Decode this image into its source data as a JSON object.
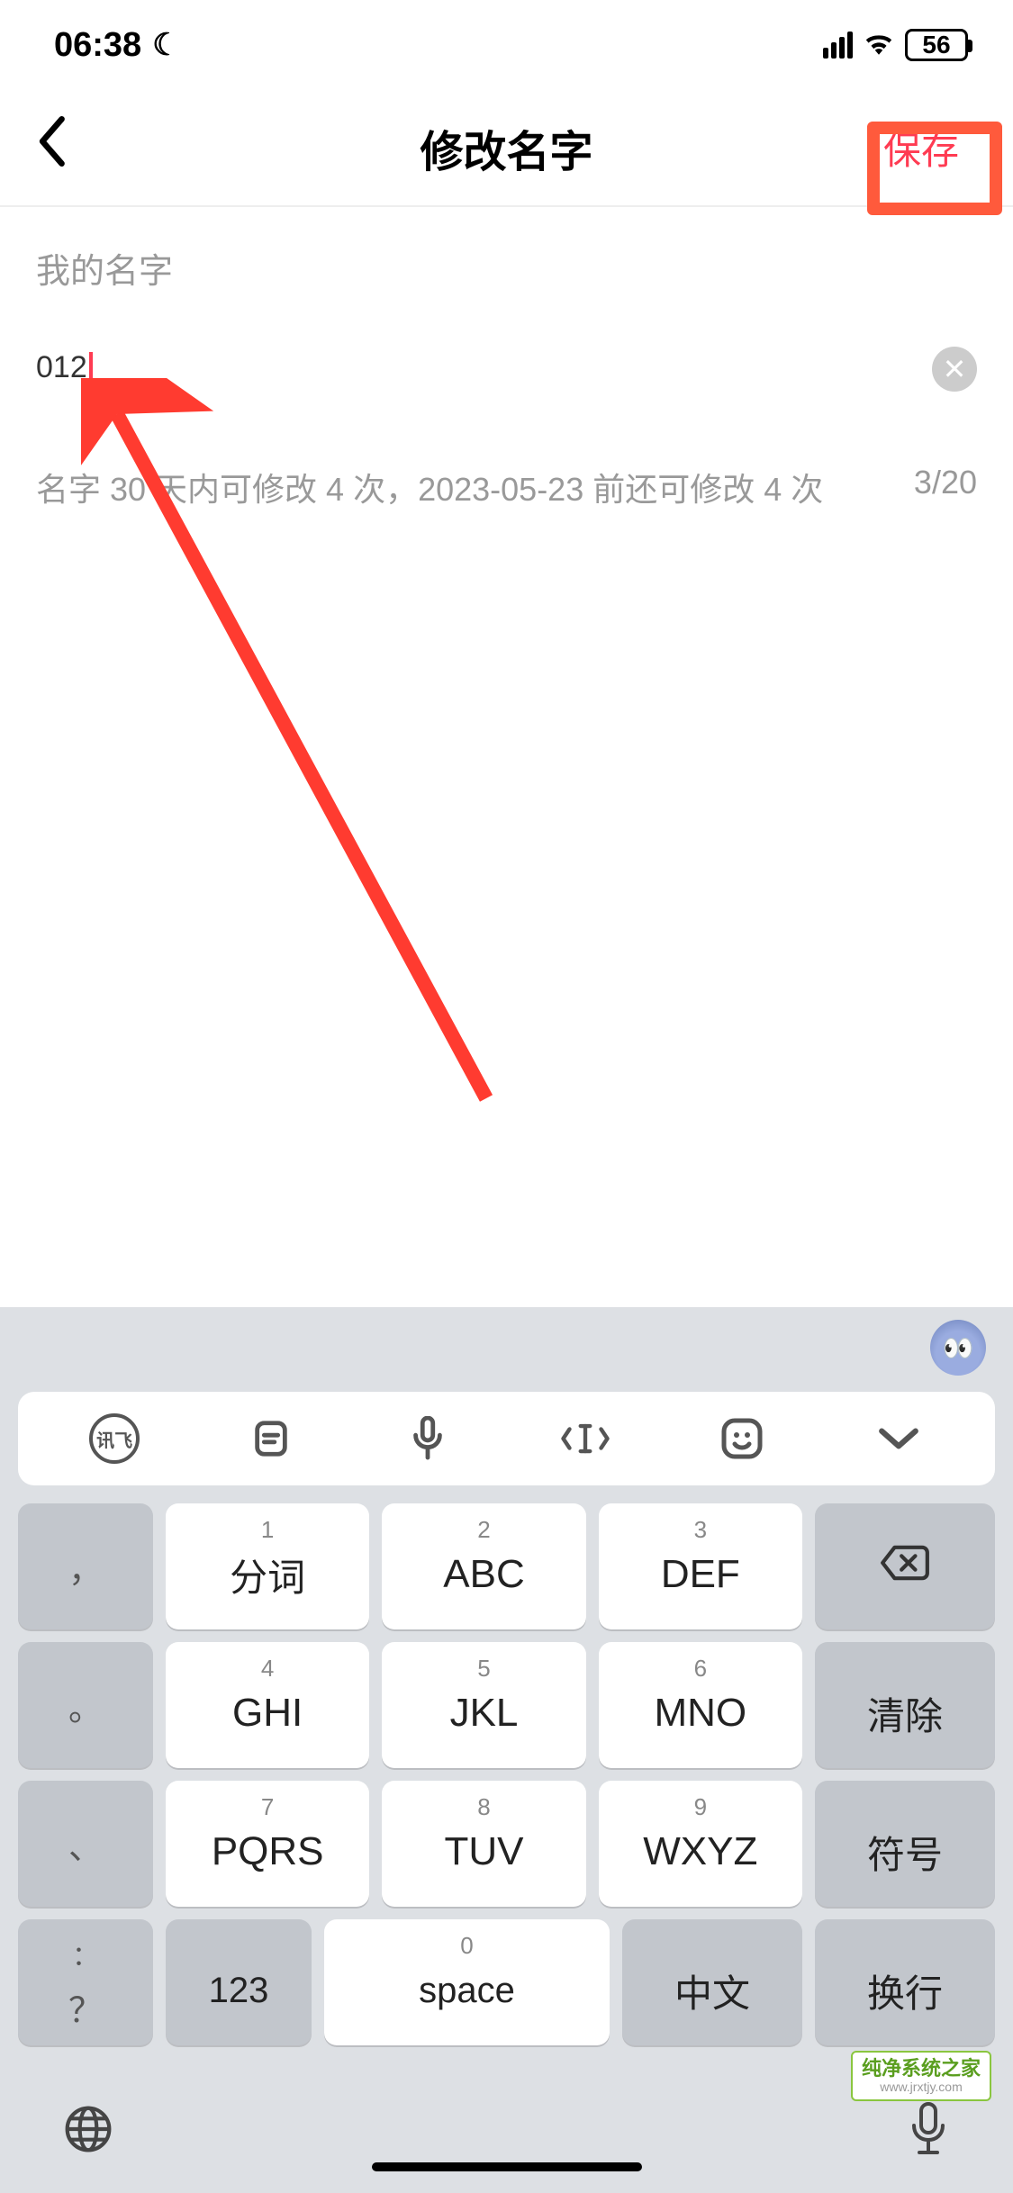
{
  "status": {
    "time": "06:38",
    "battery": "56"
  },
  "header": {
    "title": "修改名字",
    "save": "保存"
  },
  "form": {
    "label": "我的名字",
    "value": "012",
    "hint": "名字 30 天内可修改 4 次，2023-05-23 前还可修改 4 次",
    "counter": "3/20"
  },
  "keyboard": {
    "toolbar_xunfei": "讯飞",
    "rows": [
      [
        {
          "side": "，"
        },
        {
          "num": "1",
          "main": "分词"
        },
        {
          "num": "2",
          "main": "ABC"
        },
        {
          "num": "3",
          "main": "DEF"
        },
        {
          "backspace": true
        }
      ],
      [
        {
          "side": "。"
        },
        {
          "num": "4",
          "main": "GHI"
        },
        {
          "num": "5",
          "main": "JKL"
        },
        {
          "num": "6",
          "main": "MNO"
        },
        {
          "main": "清除"
        }
      ],
      [
        {
          "side": "、"
        },
        {
          "num": "7",
          "main": "PQRS"
        },
        {
          "num": "8",
          "main": "TUV"
        },
        {
          "num": "9",
          "main": "WXYZ"
        },
        {
          "main": "符号"
        }
      ],
      [
        {
          "side": "："
        },
        {
          "side": "？"
        }
      ]
    ],
    "last_row": {
      "k123": "123",
      "space_num": "0",
      "space": "space",
      "cjk": "中文",
      "enter": "换行"
    }
  },
  "watermark": {
    "text": "纯净系统之家",
    "url": "www.jrxtjy.com"
  }
}
